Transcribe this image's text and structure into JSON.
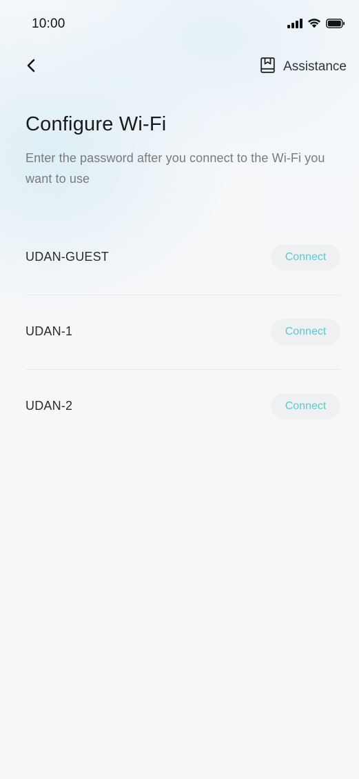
{
  "status_bar": {
    "time": "10:00",
    "icons": [
      "cellular-signal-icon",
      "wifi-icon",
      "battery-icon"
    ]
  },
  "nav": {
    "back_icon": "chevron-left-icon",
    "assistance_icon": "book-icon",
    "assistance_label": "Assistance"
  },
  "header": {
    "title": "Configure Wi-Fi",
    "subtitle": "Enter the password after you connect to the Wi-Fi you want to use"
  },
  "networks": [
    {
      "name": "UDAN-GUEST",
      "action_label": "Connect"
    },
    {
      "name": "UDAN-1",
      "action_label": "Connect"
    },
    {
      "name": "UDAN-2",
      "action_label": "Connect"
    }
  ],
  "colors": {
    "accent": "#5cc9cf",
    "button_bg": "#eef0f2",
    "background": "#f6f7f9"
  }
}
